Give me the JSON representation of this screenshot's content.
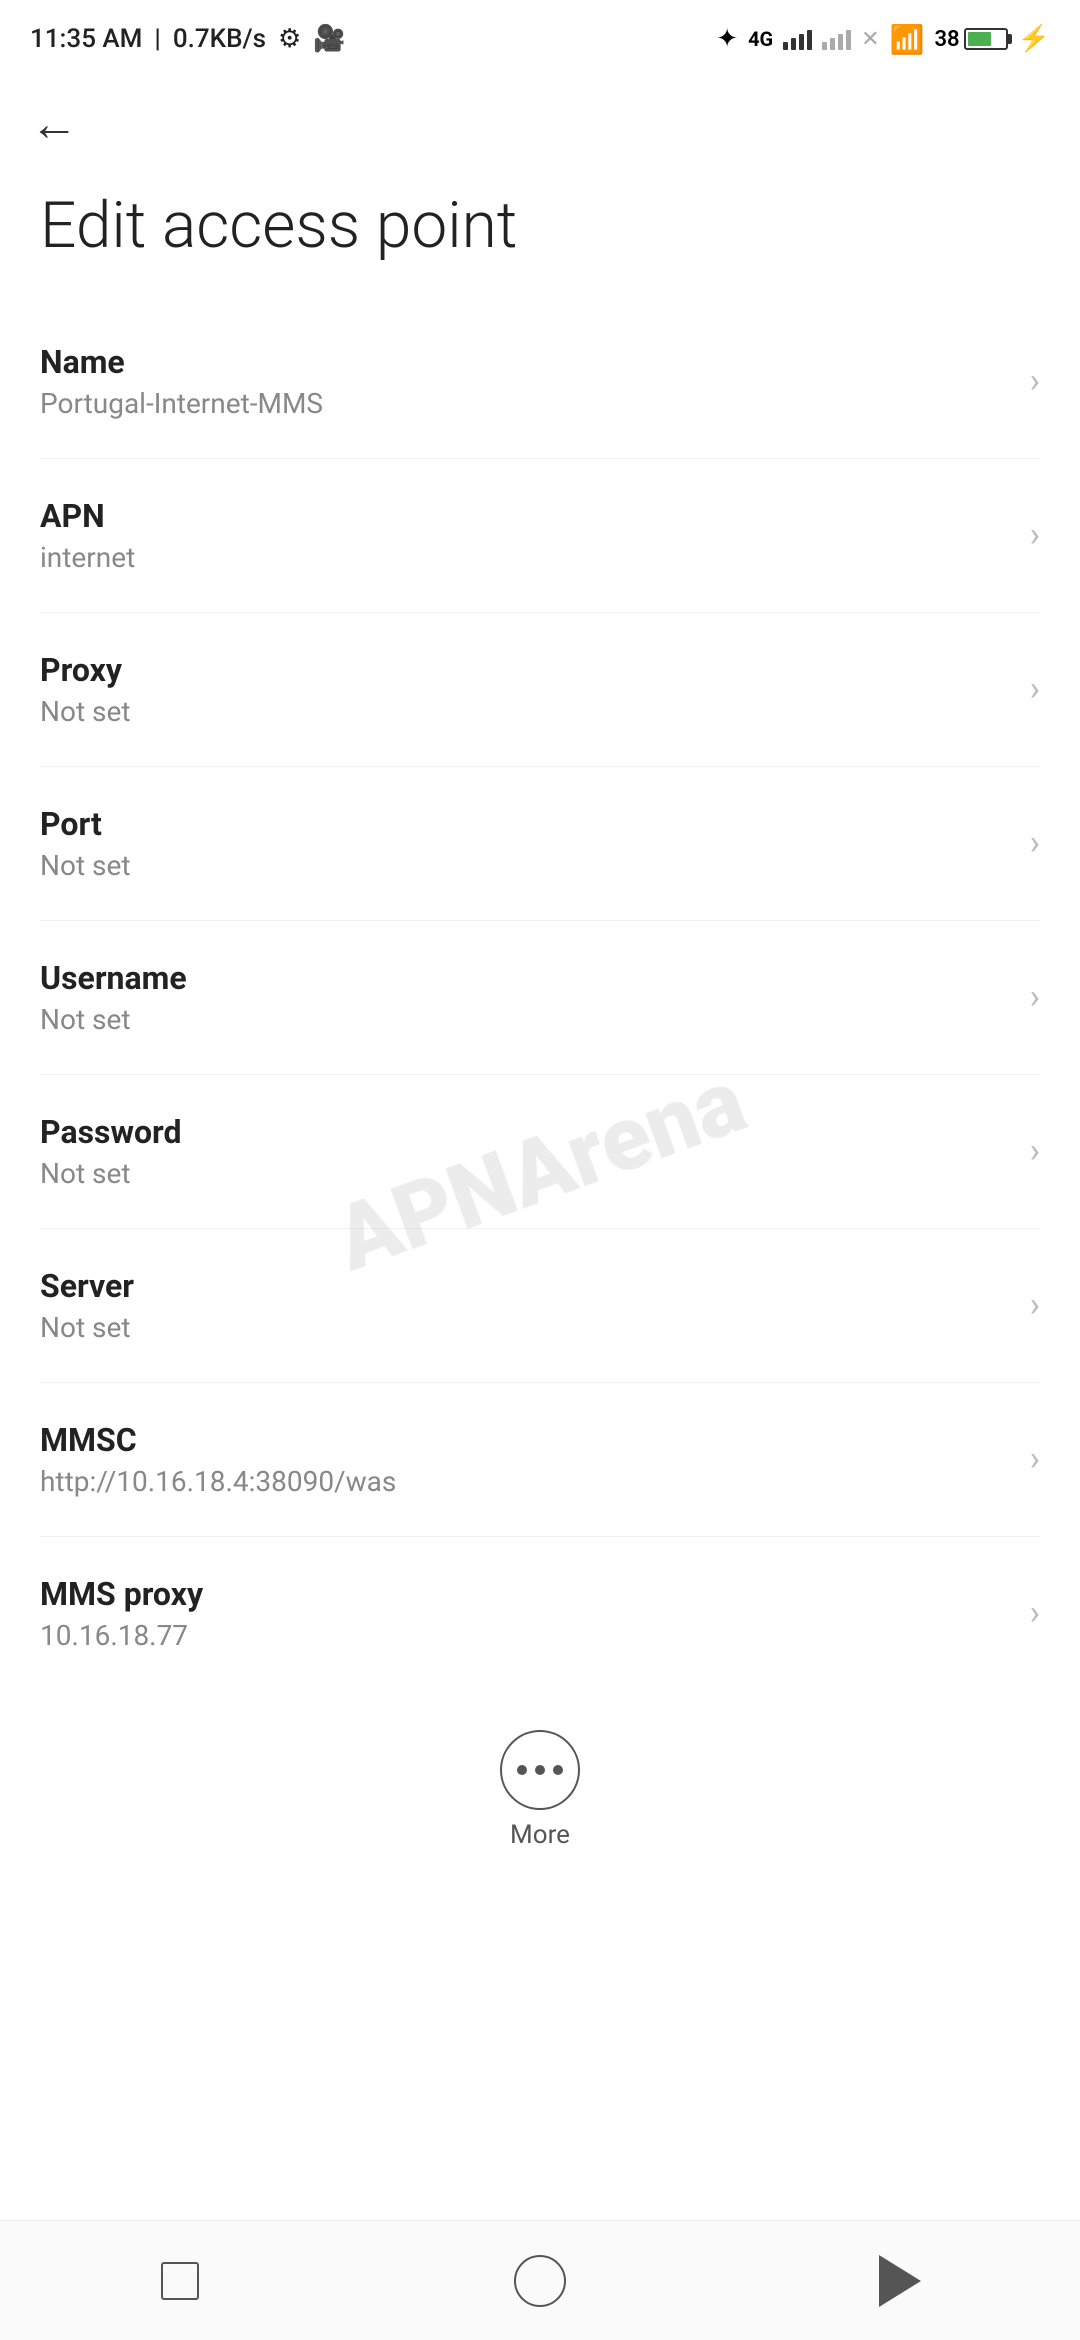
{
  "status_bar": {
    "time": "11:35 AM",
    "speed": "0.7KB/s",
    "battery_pct": "38"
  },
  "nav": {
    "back_label": "←"
  },
  "page": {
    "title": "Edit access point"
  },
  "settings_items": [
    {
      "label": "Name",
      "value": "Portugal-Internet-MMS"
    },
    {
      "label": "APN",
      "value": "internet"
    },
    {
      "label": "Proxy",
      "value": "Not set"
    },
    {
      "label": "Port",
      "value": "Not set"
    },
    {
      "label": "Username",
      "value": "Not set"
    },
    {
      "label": "Password",
      "value": "Not set"
    },
    {
      "label": "Server",
      "value": "Not set"
    },
    {
      "label": "MMSC",
      "value": "http://10.16.18.4:38090/was"
    },
    {
      "label": "MMS proxy",
      "value": "10.16.18.77"
    }
  ],
  "more_button": {
    "label": "More"
  },
  "watermark": {
    "text": "APNArena"
  },
  "bottom_nav": {
    "square_label": "recent-apps",
    "circle_label": "home",
    "triangle_label": "back"
  }
}
